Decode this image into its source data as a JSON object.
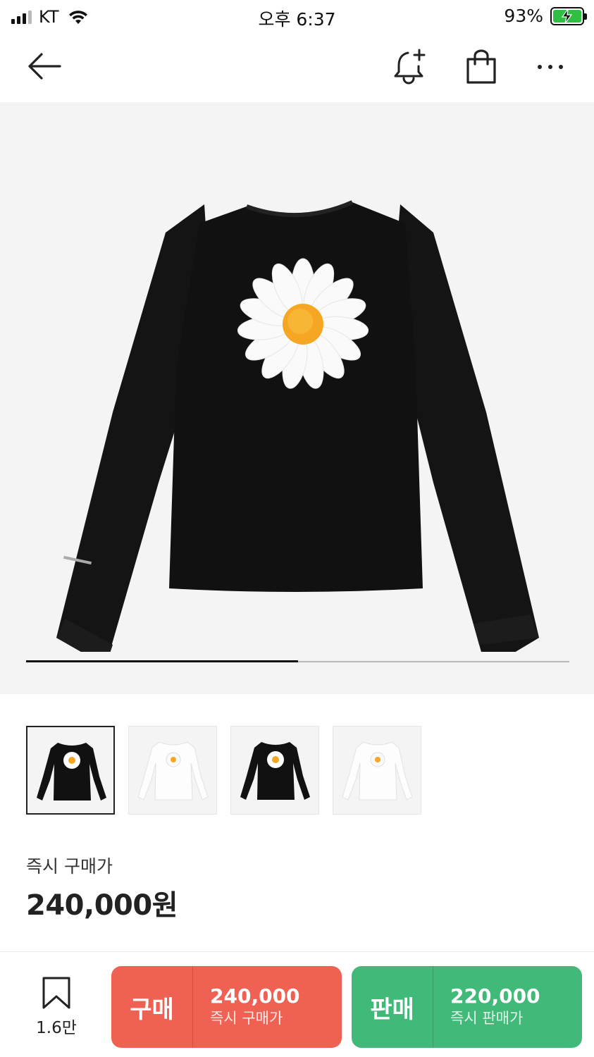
{
  "status_bar": {
    "carrier": "KT",
    "time": "오후 6:37",
    "battery_percent": "93%",
    "battery_level": 0.93,
    "charging": true
  },
  "nav": {
    "icons": [
      "back-arrow-icon",
      "bell-plus-icon",
      "shopping-bag-icon",
      "more-dots-icon"
    ]
  },
  "gallery": {
    "progress_fraction": 0.5,
    "thumbnail_count": 4,
    "active_index": 0,
    "thumbnails": [
      "black",
      "white",
      "black",
      "white"
    ]
  },
  "price": {
    "label": "즉시 구매가",
    "value": "240,000원"
  },
  "bottom": {
    "wish_count": "1.6만",
    "buy": {
      "kind": "구매",
      "amount": "240,000",
      "sub": "즉시 구매가",
      "color": "#ef6253"
    },
    "sell": {
      "kind": "판매",
      "amount": "220,000",
      "sub": "즉시 판매가",
      "color": "#41b979"
    }
  }
}
